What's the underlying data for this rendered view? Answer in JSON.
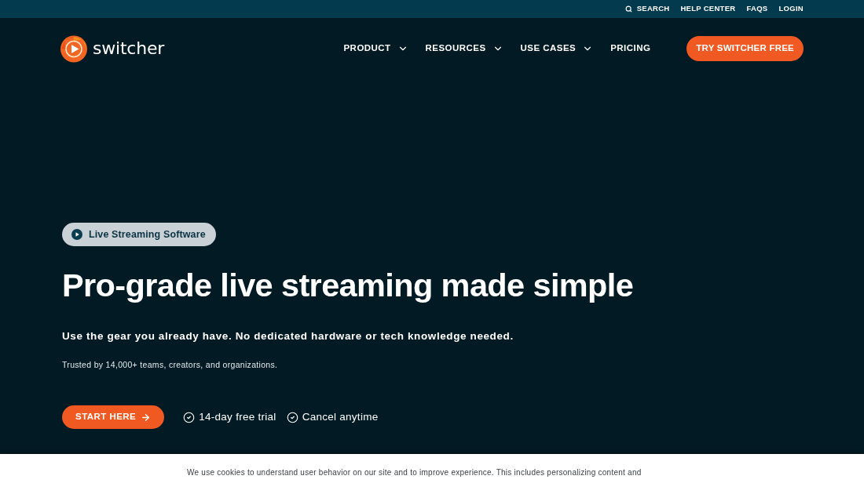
{
  "top_bar": {
    "links": [
      {
        "label": "SEARCH",
        "kind": "search"
      },
      {
        "label": "HELP CENTER",
        "kind": "link"
      },
      {
        "label": "FAQS",
        "kind": "link"
      },
      {
        "label": "LOGIN",
        "kind": "link"
      }
    ]
  },
  "nav": {
    "logo": "switcher",
    "items": [
      {
        "label": "PRODUCT",
        "dropdown": true
      },
      {
        "label": "RESOURCES",
        "dropdown": true
      },
      {
        "label": "USE CASES",
        "dropdown": true
      },
      {
        "label": "PRICING",
        "dropdown": false
      }
    ],
    "cta": "TRY SWITCHER FREE"
  },
  "hero": {
    "badge": "Live Streaming Software",
    "title": "Pro-grade live streaming made simple",
    "subtitle": "Use the gear you already have. No dedicated hardware or tech knowledge needed.",
    "trust": "Trusted by 14,000+ teams, creators, and organizations.",
    "cta": "START HERE",
    "perks": [
      "14-day free trial",
      "Cancel anytime"
    ]
  },
  "cookie_banner": {
    "text": "We use cookies to understand user behavior on our site and to improve experience. This includes personalizing content and"
  }
}
